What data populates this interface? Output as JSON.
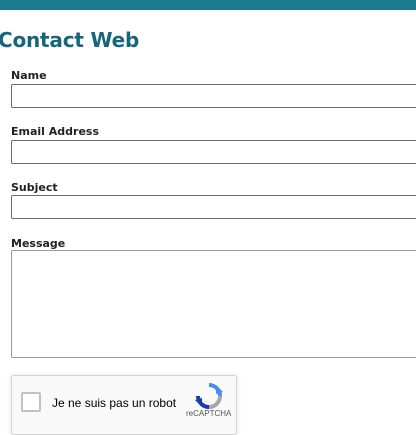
{
  "header": {
    "accent_color": "#1c7a8c"
  },
  "form": {
    "title": "Contact Web",
    "name_label": "Name",
    "name_value": "",
    "email_label": "Email Address",
    "email_value": "",
    "subject_label": "Subject",
    "subject_value": "",
    "message_label": "Message",
    "message_value": ""
  },
  "captcha": {
    "checkbox_text": "Je ne suis pas un robot",
    "brand": "reCAPTCHA",
    "checked": false,
    "logo_icon": "recaptcha-logo-icon"
  }
}
